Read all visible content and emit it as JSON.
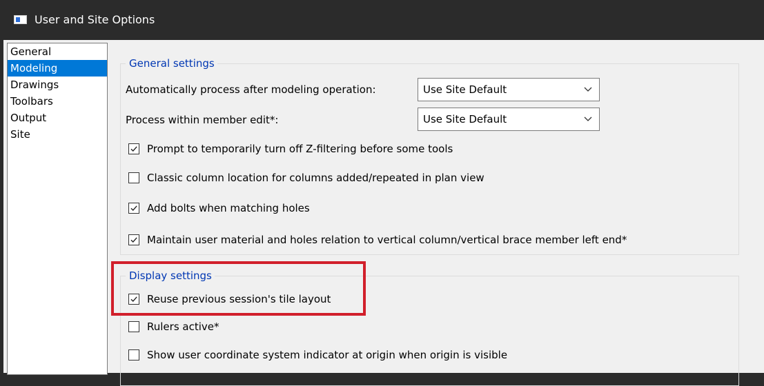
{
  "window": {
    "title": "User and Site Options",
    "icon": "app-window-icon"
  },
  "nav": {
    "items": [
      {
        "label": "General",
        "selected": false
      },
      {
        "label": "Modeling",
        "selected": true
      },
      {
        "label": "Drawings",
        "selected": false
      },
      {
        "label": "Toolbars",
        "selected": false
      },
      {
        "label": "Output",
        "selected": false
      },
      {
        "label": "Site",
        "selected": false
      }
    ]
  },
  "general_settings": {
    "title": "General settings",
    "auto_process": {
      "label": "Automatically process after modeling operation:",
      "value": "Use Site Default"
    },
    "process_within": {
      "label": "Process within member edit*:",
      "value": "Use Site Default"
    },
    "checkboxes": [
      {
        "label": "Prompt to temporarily turn off Z-filtering before some tools",
        "checked": true
      },
      {
        "label": "Classic column location for columns added/repeated in plan view",
        "checked": false
      },
      {
        "label": "Add bolts when matching holes",
        "checked": true
      },
      {
        "label": "Maintain user material and holes relation to vertical column/vertical brace member left end*",
        "checked": true
      }
    ]
  },
  "display_settings": {
    "title": "Display settings",
    "checkboxes": [
      {
        "label": "Reuse previous session's tile layout",
        "checked": true
      },
      {
        "label": "Rulers active*",
        "checked": false
      },
      {
        "label": "Show user coordinate system indicator at origin when origin is visible",
        "checked": false
      }
    ]
  },
  "colors": {
    "accent": "#0078d7",
    "group_title": "#0037b3",
    "highlight": "#d11f2b",
    "titlebar": "#2b2b2b"
  }
}
